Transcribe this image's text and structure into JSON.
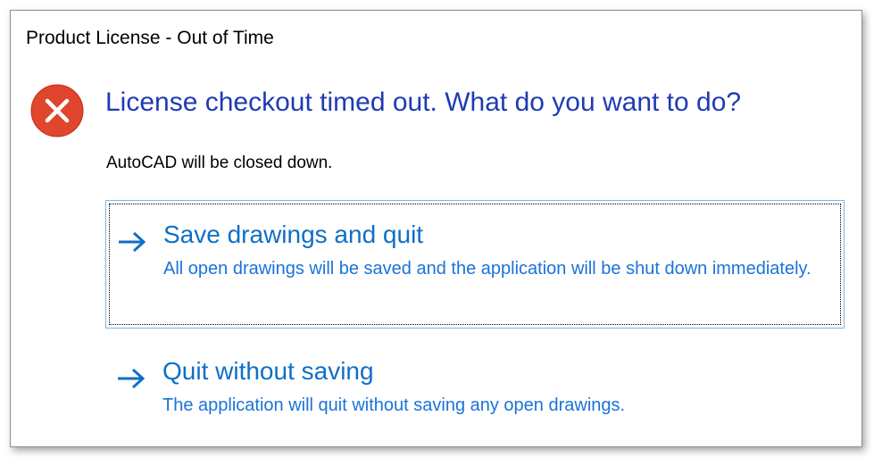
{
  "window": {
    "title": "Product License - Out of Time"
  },
  "icon": {
    "name": "error-icon",
    "color": "#e0452d"
  },
  "main_instruction": "License checkout timed out.  What do you want to do?",
  "content": "AutoCAD will be closed down.",
  "command_links": [
    {
      "icon": "arrow-right-icon",
      "title": "Save drawings and quit",
      "description": "All open drawings will be saved and the application will be shut down immediately.",
      "focused": true
    },
    {
      "icon": "arrow-right-icon",
      "title": "Quit without saving",
      "description": "The application will quit without saving any open drawings.",
      "focused": false
    }
  ],
  "colors": {
    "instruction": "#1f3bb3",
    "link_title": "#0f6fc6",
    "link_desc": "#1a73d9",
    "focus_border": "#7eb4ea"
  }
}
